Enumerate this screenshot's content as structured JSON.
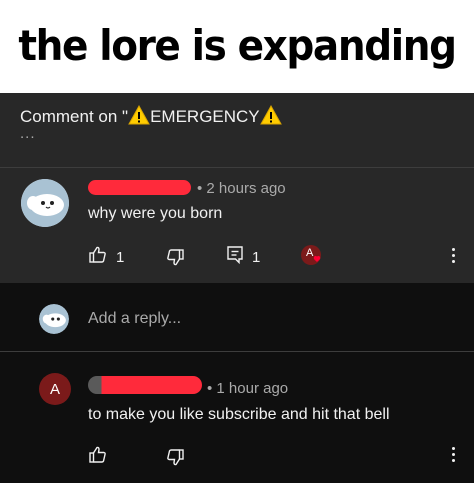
{
  "meme": {
    "caption": "the lore is expanding"
  },
  "thread": {
    "header_prefix": "Comment on \"",
    "header_title": "EMERGENCY",
    "header_more": "...",
    "warning_icon": "warning-icon"
  },
  "parent_comment": {
    "timestamp": "• 2 hours ago",
    "text": "why were you born",
    "like_count": "1",
    "reply_count": "1",
    "creator_badge_letter": "A"
  },
  "reply_box": {
    "placeholder": "Add a reply..."
  },
  "reply_comment": {
    "avatar_letter": "A",
    "timestamp": "• 1 hour ago",
    "text": "to make you like subscribe and hit that bell"
  },
  "colors": {
    "background": "#0f0f0f",
    "panel": "#282828",
    "redaction": "#ff2a3b",
    "warning": "#ffcc00",
    "heart": "#ff0033"
  }
}
